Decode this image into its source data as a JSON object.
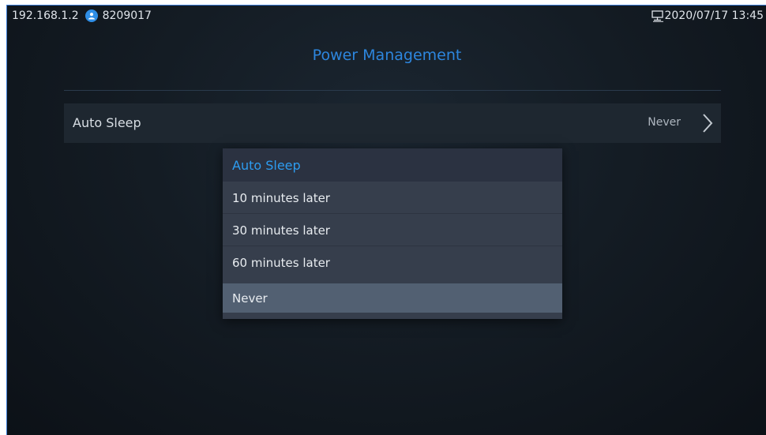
{
  "status_bar": {
    "ip": "192.168.1.2",
    "account_icon": "user-icon",
    "account": "8209017",
    "network_icon": "monitor-icon",
    "datetime": "2020/07/17 13:45"
  },
  "page": {
    "title": "Power Management"
  },
  "setting": {
    "label": "Auto Sleep",
    "value": "Never",
    "arrow_icon": "chevron-right-icon"
  },
  "dialog": {
    "title": "Auto Sleep",
    "options": [
      {
        "label": "10 minutes later"
      },
      {
        "label": "30 minutes later"
      },
      {
        "label": "60 minutes later"
      },
      {
        "label": "Never"
      }
    ],
    "selected_option": "Never"
  },
  "colors": {
    "accent": "#2d86de",
    "dialog_title": "#2d9cf0",
    "selected_row": "#526072",
    "background": "#141c24"
  }
}
